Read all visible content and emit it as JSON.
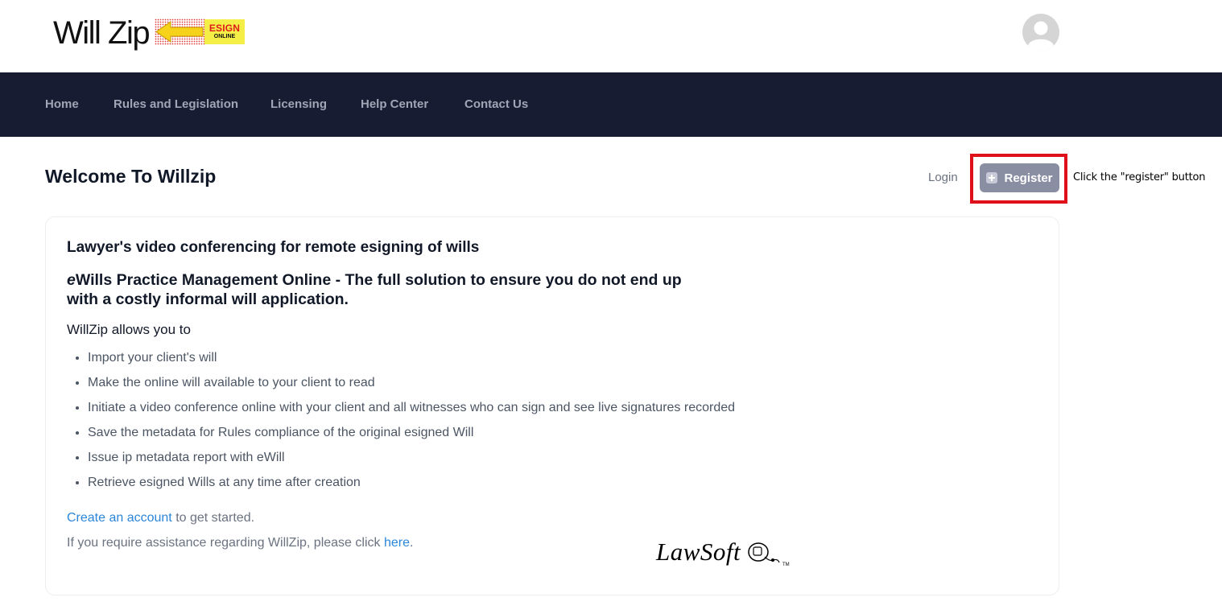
{
  "header": {
    "logo_text": "Will Zip",
    "logo_badge_line1": "ESIGN",
    "logo_badge_line2": "ONLINE"
  },
  "nav": {
    "items": [
      "Home",
      "Rules and Legislation",
      "Licensing",
      "Help Center",
      "Contact Us"
    ]
  },
  "main": {
    "title": "Welcome To Willzip",
    "login_label": "Login",
    "register_label": "Register",
    "hint_text": "Click the \"register\" button"
  },
  "card": {
    "heading1": "Lawyer's video conferencing for remote esigning of wills",
    "heading2_em": "e",
    "heading2_rest_line1": "Wills Practice Management Online - The full solution to ensure you do not end up",
    "heading2_line2": "with a costly informal will application.",
    "heading3": "WillZip allows you to",
    "features": [
      "Import your client's will",
      "Make the online will available to your client to read",
      "Initiate a video conference online with your client and all witnesses who can sign and see live signatures recorded",
      "Save the metadata for Rules compliance of the original esigned Will",
      "Issue ip metadata report with eWill",
      "Retrieve esigned Wills at any time after creation"
    ],
    "create_account_link": "Create an account",
    "create_account_suffix": " to get started.",
    "assist_prefix": "If you require assistance regarding WillZip, please click ",
    "assist_link": "here",
    "assist_suffix": "."
  },
  "footer_logo": {
    "text": "LawSoft",
    "tm": "TM"
  },
  "colors": {
    "nav_bg": "#181c33",
    "register_bg": "#8a8ea3",
    "highlight": "#e0101a",
    "link": "#2b86d9"
  }
}
